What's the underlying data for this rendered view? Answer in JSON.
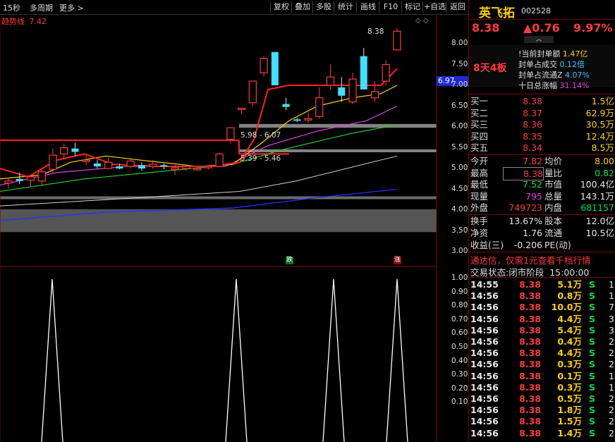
{
  "toolbar": {
    "left_items": [
      "15秒",
      "多周期",
      "更多 >"
    ],
    "buttons": [
      "复权",
      "叠加",
      "多股",
      "统计",
      "画线",
      "F10",
      "标记",
      "+自选",
      "返回"
    ]
  },
  "indicator": {
    "name": "趋势线",
    "value": "7.42"
  },
  "main_chart": {
    "y_ticks": [
      "8.00",
      "7.50",
      "7.00",
      "6.50",
      "6.00",
      "5.50",
      "5.00",
      "4.50",
      "4.00",
      "3.50",
      "3.00"
    ],
    "max_label": "8.38",
    "current_price_tag": "6.97",
    "zone_labels": [
      "5.98 - 6.07",
      "5.39 - 5.46"
    ],
    "markers": {
      "down": "跌",
      "up": "涨"
    }
  },
  "chart_data": {
    "type": "candlestick",
    "y_range": [
      2.9,
      8.4
    ],
    "candles": [
      {
        "o": 4.65,
        "h": 4.78,
        "l": 4.52,
        "c": 4.7
      },
      {
        "o": 4.75,
        "h": 4.9,
        "l": 4.62,
        "c": 4.7
      },
      {
        "o": 4.72,
        "h": 4.85,
        "l": 4.55,
        "c": 4.8
      },
      {
        "o": 4.7,
        "h": 4.98,
        "l": 4.6,
        "c": 4.92
      },
      {
        "o": 4.98,
        "h": 5.48,
        "l": 4.9,
        "c": 5.32
      },
      {
        "o": 5.35,
        "h": 5.6,
        "l": 5.2,
        "c": 5.5
      },
      {
        "o": 5.48,
        "h": 5.62,
        "l": 5.3,
        "c": 5.4
      },
      {
        "o": 5.18,
        "h": 5.32,
        "l": 5.08,
        "c": 5.2
      },
      {
        "o": 5.12,
        "h": 5.2,
        "l": 5.0,
        "c": 5.05
      },
      {
        "o": 5.0,
        "h": 5.25,
        "l": 4.98,
        "c": 5.15
      },
      {
        "o": 5.05,
        "h": 5.12,
        "l": 4.98,
        "c": 5.0
      },
      {
        "o": 5.05,
        "h": 5.22,
        "l": 5.0,
        "c": 5.18
      },
      {
        "o": 5.08,
        "h": 5.15,
        "l": 4.95,
        "c": 5.0
      },
      {
        "o": 5.05,
        "h": 5.2,
        "l": 5.0,
        "c": 5.1
      },
      {
        "o": 5.08,
        "h": 5.12,
        "l": 4.98,
        "c": 5.05
      },
      {
        "o": 4.98,
        "h": 5.08,
        "l": 4.85,
        "c": 5.02
      },
      {
        "o": 5.0,
        "h": 5.1,
        "l": 4.95,
        "c": 5.05
      },
      {
        "o": 4.98,
        "h": 5.05,
        "l": 4.95,
        "c": 5.0
      },
      {
        "o": 5.02,
        "h": 5.08,
        "l": 4.98,
        "c": 5.05
      },
      {
        "o": 5.05,
        "h": 5.38,
        "l": 5.02,
        "c": 5.35
      },
      {
        "o": 5.7,
        "h": 5.98,
        "l": 5.6,
        "c": 5.98
      },
      {
        "o": 6.45,
        "h": 6.45,
        "l": 6.3,
        "c": 6.45
      },
      {
        "o": 6.58,
        "h": 7.1,
        "l": 6.5,
        "c": 7.1
      },
      {
        "o": 7.3,
        "h": 7.7,
        "l": 7.2,
        "c": 7.65
      },
      {
        "o": 7.8,
        "h": 7.8,
        "l": 7.0,
        "c": 7.0
      },
      {
        "o": 6.55,
        "h": 6.7,
        "l": 6.4,
        "c": 6.48
      },
      {
        "o": 6.18,
        "h": 6.22,
        "l": 6.12,
        "c": 6.17
      },
      {
        "o": 6.2,
        "h": 6.35,
        "l": 6.1,
        "c": 6.2
      },
      {
        "o": 6.25,
        "h": 6.95,
        "l": 6.2,
        "c": 6.7
      },
      {
        "o": 7.0,
        "h": 7.5,
        "l": 6.9,
        "c": 7.2
      },
      {
        "o": 6.95,
        "h": 7.2,
        "l": 6.6,
        "c": 6.75
      },
      {
        "o": 6.6,
        "h": 7.3,
        "l": 6.55,
        "c": 7.15
      },
      {
        "o": 7.7,
        "h": 7.9,
        "l": 6.9,
        "c": 6.9
      },
      {
        "o": 6.7,
        "h": 7.1,
        "l": 6.6,
        "c": 6.85
      },
      {
        "o": 7.1,
        "h": 7.6,
        "l": 7.0,
        "c": 7.5
      },
      {
        "o": 7.85,
        "h": 8.38,
        "l": 7.85,
        "c": 8.3
      }
    ],
    "bottom_ticks": [
      "1.00",
      "0.90",
      "0.80",
      "0.70",
      "0.60",
      "0.50",
      "0.40",
      "0.30",
      "0.20",
      "0.10"
    ],
    "signal_peaks": [
      74,
      335,
      473,
      563
    ]
  },
  "stock": {
    "name": "英飞拓",
    "code": "002528",
    "price": "8.38",
    "change": "▲0.76",
    "pct": "9.97%",
    "board": "8天4板",
    "seal_info": [
      {
        "label": "!当前封单额",
        "value": "1.47亿"
      },
      {
        "label": "封单占成交",
        "value": "0.12倍"
      },
      {
        "label": "封单占流通Z",
        "value": "4.07%"
      },
      {
        "label": "十日总涨幅",
        "value": "31.14%"
      }
    ],
    "bids": [
      {
        "label": "买一",
        "price": "8.38",
        "vol": "1.5亿"
      },
      {
        "label": "买二",
        "price": "8.37",
        "vol": "62.9万"
      },
      {
        "label": "买三",
        "price": "8.36",
        "vol": "30.5万"
      },
      {
        "label": "买四",
        "price": "8.35",
        "vol": "12.4万"
      },
      {
        "label": "买五",
        "price": "8.34",
        "vol": "8.5万"
      }
    ],
    "stats": [
      {
        "l1": "今开",
        "v1": "7.82",
        "l2": "均价",
        "v2": "8.00"
      },
      {
        "l1": "最高",
        "v1": "8.38",
        "l2": "量比",
        "v2": "0.82"
      },
      {
        "l1": "最低",
        "v1": "7.52",
        "l2": "市值",
        "v2": "100.4亿"
      },
      {
        "l1": "现量",
        "v1": "795",
        "l2": "总量",
        "v2": "143.1万"
      },
      {
        "l1": "外盘",
        "v1": "749723",
        "l2": "内盘",
        "v2": "681157"
      }
    ],
    "fundamentals": [
      {
        "l1": "换手",
        "v1": "13.67%",
        "l2": "股本",
        "v2": "12.0亿"
      },
      {
        "l1": "净资",
        "v1": "1.76",
        "l2": "流通",
        "v2": "10.5亿"
      },
      {
        "l1": "收益(三)",
        "v1": "-0.206",
        "l2": "PE(动)",
        "v2": ""
      }
    ],
    "promo": "通达信，仅需1元查看千档行情",
    "trade_status_label": "交易状态:",
    "trade_status": "闭市阶段",
    "trade_time": "15:00:00",
    "ticks": [
      {
        "t": "14:55",
        "p": "8.38",
        "v": "5.1万",
        "s": "S",
        "n": "1"
      },
      {
        "t": "14:56",
        "p": "8.38",
        "v": "0.8万",
        "s": "S",
        "n": "1"
      },
      {
        "t": "14:56",
        "p": "8.38",
        "v": "10.0万",
        "s": "S",
        "n": "7"
      },
      {
        "t": "14:56",
        "p": "8.38",
        "v": "4.4万",
        "s": "S",
        "n": "3"
      },
      {
        "t": "14:56",
        "p": "8.38",
        "v": "5.4万",
        "s": "S",
        "n": "3"
      },
      {
        "t": "14:56",
        "p": "8.38",
        "v": "0.4万",
        "s": "S",
        "n": "2"
      },
      {
        "t": "14:56",
        "p": "8.38",
        "v": "4.4万",
        "s": "S",
        "n": "2"
      },
      {
        "t": "14:56",
        "p": "8.38",
        "v": "0.3万",
        "s": "S",
        "n": "2"
      },
      {
        "t": "14:56",
        "p": "8.38",
        "v": "0.1万",
        "s": "S",
        "n": "1"
      },
      {
        "t": "14:56",
        "p": "8.38",
        "v": "0.3万",
        "s": "S",
        "n": "1"
      },
      {
        "t": "14:56",
        "p": "8.38",
        "v": "0.5万",
        "s": "S",
        "n": "2"
      },
      {
        "t": "14:56",
        "p": "8.38",
        "v": "1.8万",
        "s": "S",
        "n": "2"
      },
      {
        "t": "14:56",
        "p": "8.38",
        "v": "1.5万",
        "s": "S",
        "n": "2"
      },
      {
        "t": "14:56",
        "p": "8.38",
        "v": "1.4万",
        "s": "S",
        "n": "2"
      }
    ]
  },
  "colors": {
    "up": "#ff3b3b",
    "down": "#40e0ff",
    "bg": "#000000",
    "accent": "#ffd200"
  }
}
